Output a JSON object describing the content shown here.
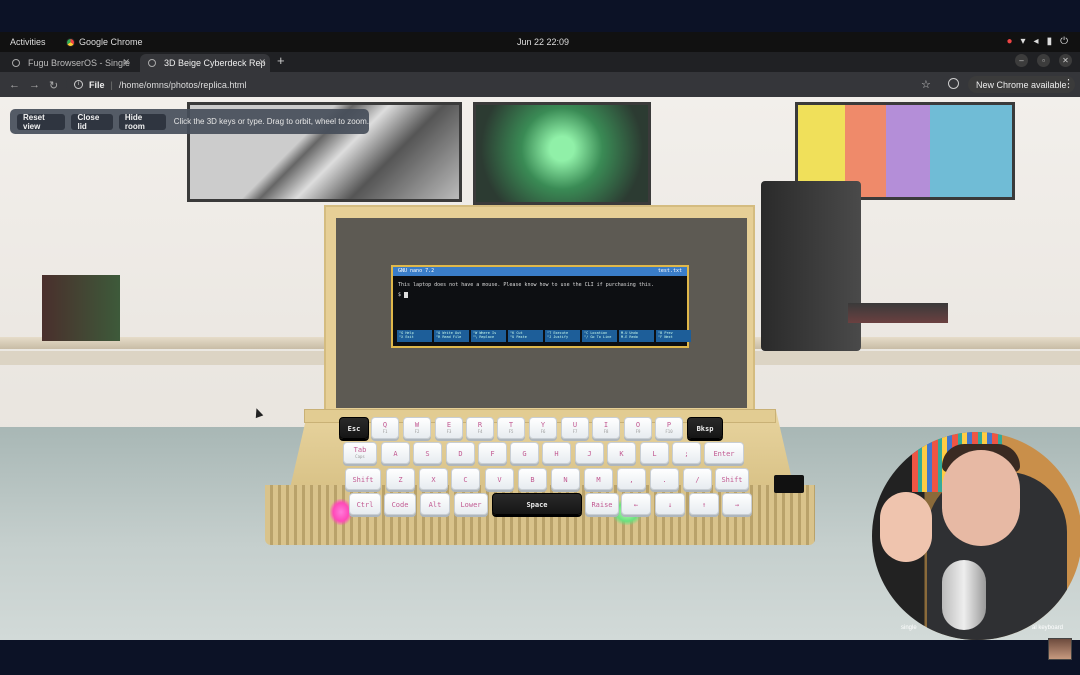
{
  "system_bar": {
    "activities": "Activities",
    "app_name": "Google Chrome",
    "datetime": "Jun 22  22:09"
  },
  "browser": {
    "tabs": [
      {
        "label": "Fugu BrowserOS - Single",
        "active": false
      },
      {
        "label": "3D Beige Cyberdeck Rep",
        "active": true
      }
    ],
    "new_tab": "+",
    "url_scheme": "File",
    "url": "/home/omns/photos/replica.html",
    "update_label": "New Chrome available"
  },
  "overlay": {
    "reset_view": "Reset view",
    "close_lid": "Close lid",
    "hide_room": "Hide room",
    "hint": "Click the 3D keys or type. Drag to orbit, wheel to zoom."
  },
  "terminal": {
    "title_left": "GNU nano 7.2",
    "title_right": "test.txt",
    "line1": "This laptop does not have a mouse. Please know how to use the CLI if purchasing this.",
    "prompt": "$",
    "footer": [
      {
        "k1": "^G Help",
        "k2": "^X Exit"
      },
      {
        "k1": "^O Write Out",
        "k2": "^R Read File"
      },
      {
        "k1": "^W Where Is",
        "k2": "^\\ Replace"
      },
      {
        "k1": "^K Cut",
        "k2": "^U Paste"
      },
      {
        "k1": "^T Execute",
        "k2": "^J Justify"
      },
      {
        "k1": "^C Location",
        "k2": "^/ Go To Line"
      },
      {
        "k1": "M-U Undo",
        "k2": "M-E Redo"
      },
      {
        "k1": "^B Prev",
        "k2": "^F Next"
      }
    ]
  },
  "keyboard": {
    "row1": [
      {
        "label": "Esc",
        "sub": "",
        "dark": true
      },
      {
        "label": "Q",
        "sub": "F1"
      },
      {
        "label": "W",
        "sub": "F2"
      },
      {
        "label": "E",
        "sub": "F3"
      },
      {
        "label": "R",
        "sub": "F4"
      },
      {
        "label": "T",
        "sub": "F5"
      },
      {
        "label": "Y",
        "sub": "F6"
      },
      {
        "label": "U",
        "sub": "F7"
      },
      {
        "label": "I",
        "sub": "F8"
      },
      {
        "label": "O",
        "sub": "F9"
      },
      {
        "label": "P",
        "sub": "F10"
      },
      {
        "label": "Bksp",
        "sub": "",
        "dark": true
      }
    ],
    "row2": [
      {
        "label": "Tab",
        "sub": "Caps"
      },
      {
        "label": "A",
        "sub": ""
      },
      {
        "label": "S",
        "sub": ""
      },
      {
        "label": "D",
        "sub": ""
      },
      {
        "label": "F",
        "sub": ""
      },
      {
        "label": "G",
        "sub": ""
      },
      {
        "label": "H",
        "sub": ""
      },
      {
        "label": "J",
        "sub": ""
      },
      {
        "label": "K",
        "sub": ""
      },
      {
        "label": "L",
        "sub": ""
      },
      {
        "label": ";",
        "sub": ""
      },
      {
        "label": "Enter",
        "sub": ""
      }
    ],
    "row3": [
      {
        "label": "Shift",
        "sub": ""
      },
      {
        "label": "Z",
        "sub": ""
      },
      {
        "label": "X",
        "sub": ""
      },
      {
        "label": "C",
        "sub": ""
      },
      {
        "label": "V",
        "sub": ""
      },
      {
        "label": "B",
        "sub": ""
      },
      {
        "label": "N",
        "sub": ""
      },
      {
        "label": "M",
        "sub": ""
      },
      {
        "label": ",",
        "sub": ""
      },
      {
        "label": ".",
        "sub": ""
      },
      {
        "label": "/",
        "sub": ""
      },
      {
        "label": "Shift",
        "sub": ""
      }
    ],
    "row4": [
      {
        "label": "Ctrl",
        "sub": ""
      },
      {
        "label": "Code",
        "sub": ""
      },
      {
        "label": "Alt",
        "sub": ""
      },
      {
        "label": "Lower",
        "sub": ""
      },
      {
        "label": "Space",
        "sub": "",
        "dark": true
      },
      {
        "label": "Raise",
        "sub": ""
      },
      {
        "label": "←",
        "sub": ""
      },
      {
        "label": "↓",
        "sub": ""
      },
      {
        "label": "↑",
        "sub": ""
      },
      {
        "label": "→",
        "sub": ""
      }
    ]
  },
  "webcam": {
    "caption_left": "single",
    "caption_right": "al keyboard"
  },
  "colors": {
    "accent_term": "#3a7dc8",
    "key_legend": "#c25a92",
    "lid": "#e6cf96"
  },
  "icons": [
    "globe-icon",
    "close-icon",
    "back-icon",
    "forward-icon",
    "reload-icon",
    "info-icon",
    "star-icon",
    "profile-icon",
    "kebab-menu-icon"
  ]
}
